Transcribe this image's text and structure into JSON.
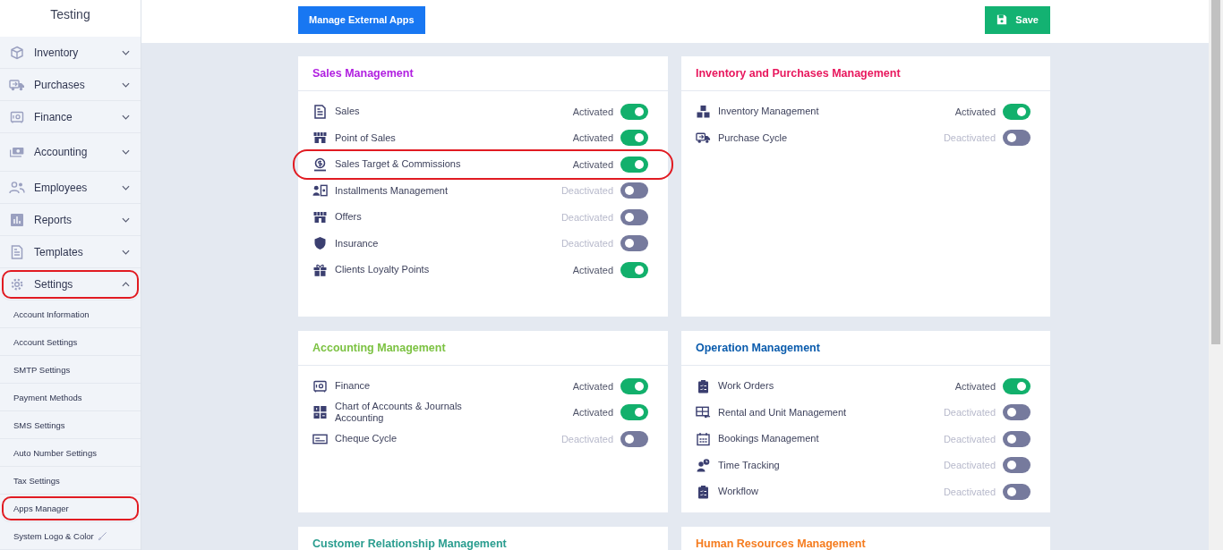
{
  "sidebar": {
    "title": "Testing",
    "items": [
      {
        "label": "Inventory",
        "expanded": false,
        "highlighted": false
      },
      {
        "label": "Purchases",
        "expanded": false,
        "highlighted": false
      },
      {
        "label": "Finance",
        "expanded": false,
        "highlighted": false
      },
      {
        "label": "Accounting",
        "expanded": false,
        "highlighted": false
      },
      {
        "label": "Employees",
        "expanded": false,
        "highlighted": false
      },
      {
        "label": "Reports",
        "expanded": false,
        "highlighted": false
      },
      {
        "label": "Templates",
        "expanded": false,
        "highlighted": false
      },
      {
        "label": "Settings",
        "expanded": true,
        "highlighted": true,
        "children": [
          {
            "label": "Account Information",
            "highlighted": false
          },
          {
            "label": "Account Settings",
            "highlighted": false
          },
          {
            "label": "SMTP Settings",
            "highlighted": false
          },
          {
            "label": "Payment Methods",
            "highlighted": false
          },
          {
            "label": "SMS Settings",
            "highlighted": false
          },
          {
            "label": "Auto Number Settings",
            "highlighted": false
          },
          {
            "label": "Tax Settings",
            "highlighted": false
          },
          {
            "label": "Apps Manager",
            "highlighted": true
          },
          {
            "label": "System Logo & Color",
            "highlighted": false
          }
        ]
      }
    ]
  },
  "toolbar": {
    "manage_button": "Manage External Apps",
    "save_button": "Save"
  },
  "sections": [
    {
      "title": "Sales Management",
      "color": "#b01ee0",
      "apps": [
        {
          "name": "Sales",
          "status": "Activated",
          "on": true,
          "highlighted": false
        },
        {
          "name": "Point of Sales",
          "status": "Activated",
          "on": true,
          "highlighted": false
        },
        {
          "name": "Sales Target & Commissions",
          "status": "Activated",
          "on": true,
          "highlighted": true
        },
        {
          "name": "Installments Management",
          "status": "Deactivated",
          "on": false,
          "highlighted": false
        },
        {
          "name": "Offers",
          "status": "Deactivated",
          "on": false,
          "highlighted": false
        },
        {
          "name": "Insurance",
          "status": "Deactivated",
          "on": false,
          "highlighted": false
        },
        {
          "name": "Clients Loyalty Points",
          "status": "Activated",
          "on": true,
          "highlighted": false
        }
      ]
    },
    {
      "title": "Inventory and Purchases Management",
      "color": "#e8175d",
      "apps": [
        {
          "name": "Inventory Management",
          "status": "Activated",
          "on": true,
          "highlighted": false
        },
        {
          "name": "Purchase Cycle",
          "status": "Deactivated",
          "on": false,
          "highlighted": false
        }
      ]
    },
    {
      "title": "Accounting Management",
      "color": "#7cc242",
      "apps": [
        {
          "name": "Finance",
          "status": "Activated",
          "on": true,
          "highlighted": false
        },
        {
          "name": "Chart of Accounts & Journals Accounting",
          "status": "Activated",
          "on": true,
          "highlighted": false
        },
        {
          "name": "Cheque Cycle",
          "status": "Deactivated",
          "on": false,
          "highlighted": false
        }
      ]
    },
    {
      "title": "Operation Management",
      "color": "#0b5cad",
      "apps": [
        {
          "name": "Work Orders",
          "status": "Activated",
          "on": true,
          "highlighted": false
        },
        {
          "name": "Rental and Unit Management",
          "status": "Deactivated",
          "on": false,
          "highlighted": false
        },
        {
          "name": "Bookings Management",
          "status": "Deactivated",
          "on": false,
          "highlighted": false
        },
        {
          "name": "Time Tracking",
          "status": "Deactivated",
          "on": false,
          "highlighted": false
        },
        {
          "name": "Workflow",
          "status": "Deactivated",
          "on": false,
          "highlighted": false
        }
      ]
    },
    {
      "title": "Customer Relationship Management",
      "color": "#2a9d8f"
    },
    {
      "title": "Human Resources Management",
      "color": "#f57c1f"
    }
  ]
}
